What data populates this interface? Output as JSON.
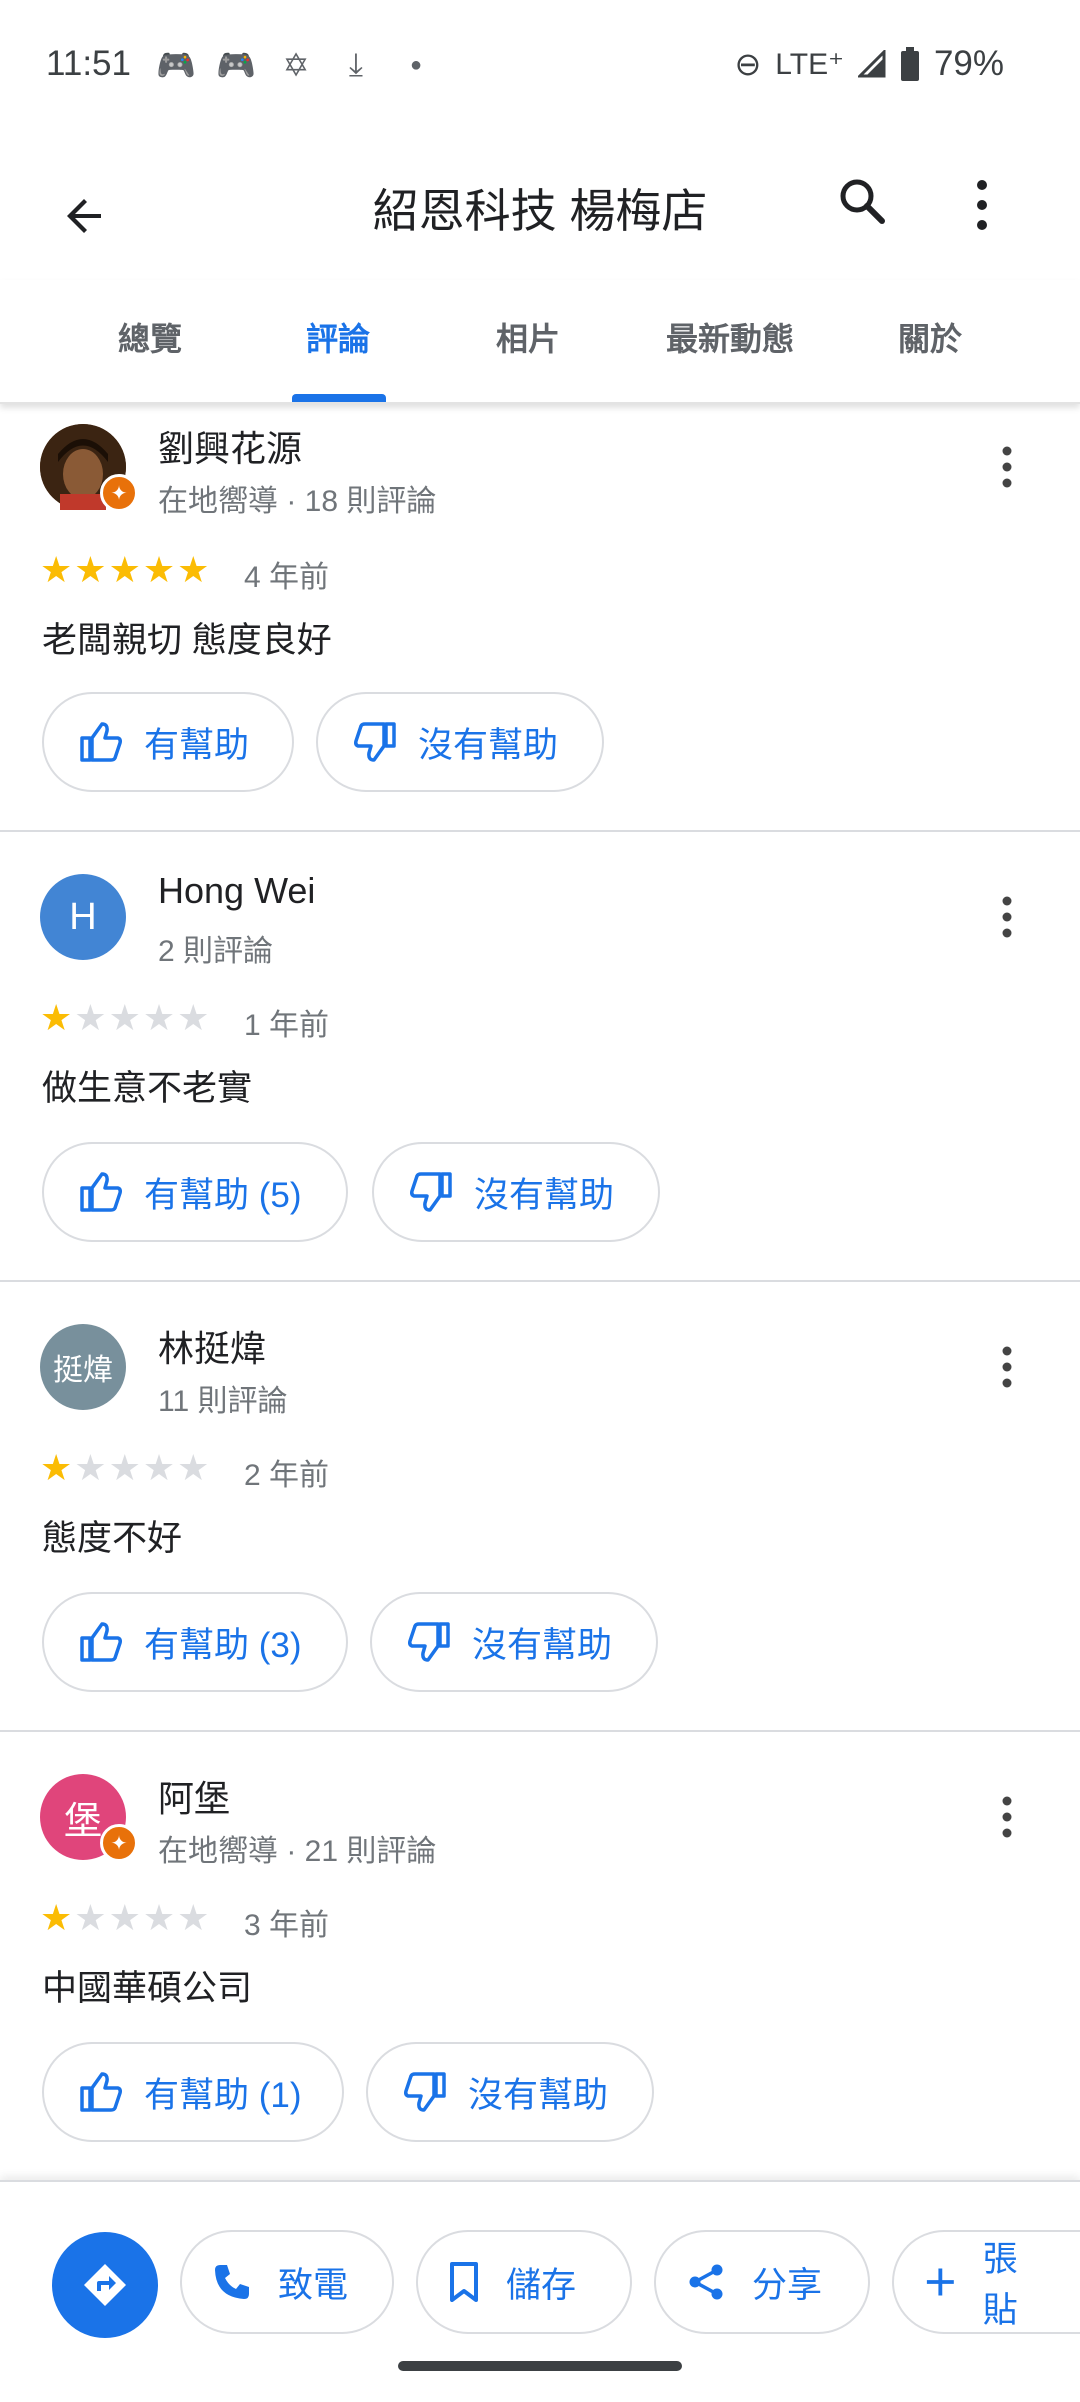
{
  "status": {
    "time": "11:51",
    "left_icons": [
      "game-controller-icon",
      "game-controller-icon",
      "star-of-david-icon",
      "download-icon",
      "dot-icon"
    ],
    "network": "LTE⁺",
    "battery": "79%"
  },
  "header": {
    "title": "紹恩科技 楊梅店"
  },
  "tabs": [
    {
      "label": "總覽"
    },
    {
      "label": "評論"
    },
    {
      "label": "相片"
    },
    {
      "label": "最新動態"
    },
    {
      "label": "關於"
    }
  ],
  "active_tab": "評論",
  "reviews": [
    {
      "name": "劉興花源",
      "meta": "在地嚮導 · 18 則評論",
      "rating": 5,
      "date": "4 年前",
      "text": "老闆親切 態度良好",
      "helpful_label": "有幫助",
      "not_helpful_label": "沒有幫助",
      "avatar_letter": "",
      "avatar_color": "#5d3a1a",
      "local_guide": true
    },
    {
      "name": "Hong Wei",
      "meta": "2 則評論",
      "rating": 1,
      "date": "1 年前",
      "text": "做生意不老實",
      "helpful_label": "有幫助 (5)",
      "not_helpful_label": "沒有幫助",
      "avatar_letter": "H",
      "avatar_color": "#4285d4",
      "local_guide": false
    },
    {
      "name": "林挺煒",
      "meta": "11 則評論",
      "rating": 1,
      "date": "2 年前",
      "text": "態度不好",
      "helpful_label": "有幫助 (3)",
      "not_helpful_label": "沒有幫助",
      "avatar_letter": "挺煒",
      "avatar_color": "#78909c",
      "local_guide": false
    },
    {
      "name": "阿堡",
      "meta": "在地嚮導 · 21 則評論",
      "rating": 1,
      "date": "3 年前",
      "text": "中國華碩公司",
      "helpful_label": "有幫助 (1)",
      "not_helpful_label": "沒有幫助",
      "avatar_letter": "堡",
      "avatar_color": "#e0457b",
      "local_guide": true
    }
  ],
  "actions": {
    "call": "致電",
    "save": "儲存",
    "share": "分享",
    "post": "張貼"
  },
  "colors": {
    "accent": "#1a73e8",
    "star": "#fbbc04",
    "badge": "#e8710a"
  }
}
